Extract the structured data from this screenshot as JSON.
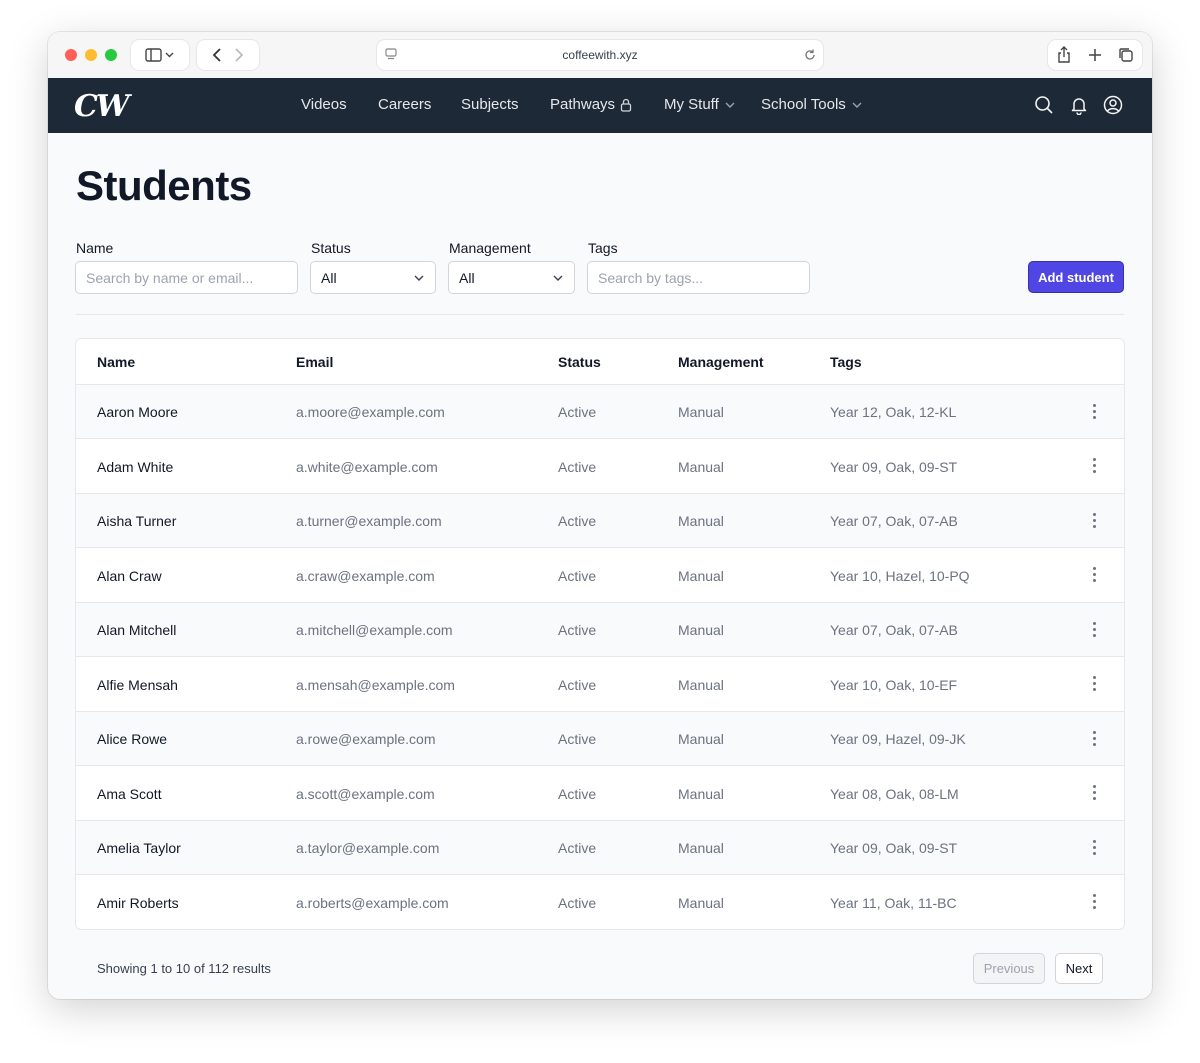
{
  "browser": {
    "url": "coffeewith.xyz"
  },
  "nav": {
    "logo": "CW",
    "items": [
      {
        "label": "Videos"
      },
      {
        "label": "Careers"
      },
      {
        "label": "Subjects"
      },
      {
        "label": "Pathways",
        "icon": "lock-icon"
      },
      {
        "label": "My Stuff",
        "icon": "chevron-down-icon"
      },
      {
        "label": "School Tools",
        "icon": "chevron-down-icon"
      }
    ],
    "right_icons": [
      "search-icon",
      "bell-icon",
      "user-circle-icon"
    ]
  },
  "page": {
    "title": "Students"
  },
  "filters": {
    "name_label": "Name",
    "name_placeholder": "Search by name or email...",
    "status_label": "Status",
    "status_value": "All",
    "management_label": "Management",
    "management_value": "All",
    "tags_label": "Tags",
    "tags_placeholder": "Search by tags...",
    "add_button": "Add student"
  },
  "table": {
    "headers": [
      "Name",
      "Email",
      "Status",
      "Management",
      "Tags"
    ],
    "rows": [
      {
        "name": "Aaron Moore",
        "email": "a.moore@example.com",
        "status": "Active",
        "management": "Manual",
        "tags": "Year 12, Oak, 12-KL"
      },
      {
        "name": "Adam White",
        "email": "a.white@example.com",
        "status": "Active",
        "management": "Manual",
        "tags": "Year 09, Oak, 09-ST"
      },
      {
        "name": "Aisha Turner",
        "email": "a.turner@example.com",
        "status": "Active",
        "management": "Manual",
        "tags": "Year 07, Oak, 07-AB"
      },
      {
        "name": "Alan Craw",
        "email": "a.craw@example.com",
        "status": "Active",
        "management": "Manual",
        "tags": "Year 10, Hazel, 10-PQ"
      },
      {
        "name": "Alan Mitchell",
        "email": "a.mitchell@example.com",
        "status": "Active",
        "management": "Manual",
        "tags": "Year 07, Oak, 07-AB"
      },
      {
        "name": "Alfie Mensah",
        "email": "a.mensah@example.com",
        "status": "Active",
        "management": "Manual",
        "tags": "Year 10, Oak, 10-EF"
      },
      {
        "name": "Alice Rowe",
        "email": "a.rowe@example.com",
        "status": "Active",
        "management": "Manual",
        "tags": "Year 09, Hazel, 09-JK"
      },
      {
        "name": "Ama Scott",
        "email": "a.scott@example.com",
        "status": "Active",
        "management": "Manual",
        "tags": "Year 08, Oak, 08-LM"
      },
      {
        "name": "Amelia Taylor",
        "email": "a.taylor@example.com",
        "status": "Active",
        "management": "Manual",
        "tags": "Year 09, Oak, 09-ST"
      },
      {
        "name": "Amir Roberts",
        "email": "a.roberts@example.com",
        "status": "Active",
        "management": "Manual",
        "tags": "Year 11, Oak, 11-BC"
      }
    ]
  },
  "pagination": {
    "summary": "Showing 1 to 10 of 112 results",
    "previous": "Previous",
    "next": "Next"
  },
  "colors": {
    "nav_bg": "#1e2937",
    "accent": "#4f46e5"
  }
}
